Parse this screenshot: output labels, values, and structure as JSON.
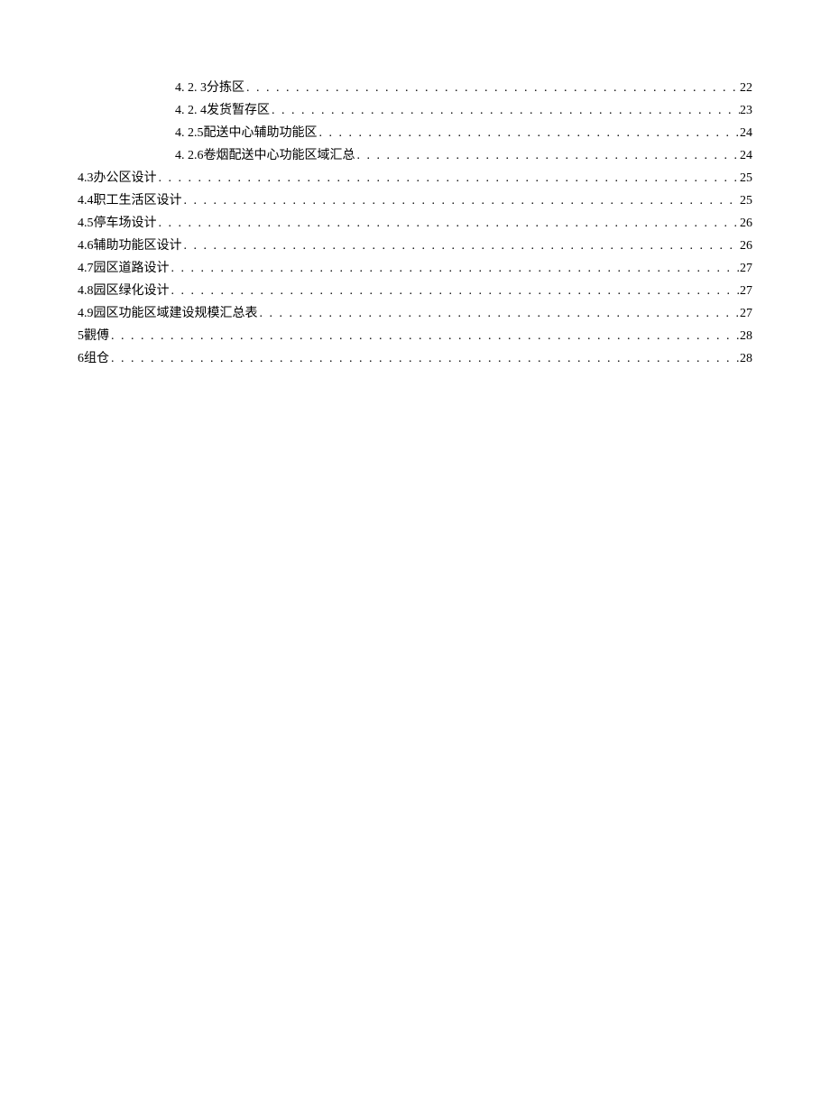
{
  "toc": [
    {
      "level": 3,
      "label": "4. 2. 3分拣区",
      "page": "22"
    },
    {
      "level": 3,
      "label": "4. 2. 4发货暂存区",
      "page": "23"
    },
    {
      "level": 3,
      "label": "4. 2.5配送中心辅助功能区",
      "page": "24"
    },
    {
      "level": 3,
      "label": "4. 2.6卷烟配送中心功能区域汇总",
      "page": "24"
    },
    {
      "level": 2,
      "label": "4.3办公区设计",
      "page": "25"
    },
    {
      "level": 2,
      "label": "4.4职工生活区设计",
      "page": "25"
    },
    {
      "level": 2,
      "label": "4.5停车场设计",
      "page": "26"
    },
    {
      "level": 2,
      "label": "4.6辅助功能区设计",
      "page": "26"
    },
    {
      "level": 2,
      "label": "4.7园区道路设计",
      "page": "27"
    },
    {
      "level": 2,
      "label": "4.8园区绿化设计",
      "page": "27"
    },
    {
      "level": 2,
      "label": "4.9园区功能区域建设规模汇总表",
      "page": "27"
    },
    {
      "level": 1,
      "label": "5觀傅",
      "page": "28"
    },
    {
      "level": 1,
      "label": "6组仓",
      "page": "28"
    }
  ]
}
